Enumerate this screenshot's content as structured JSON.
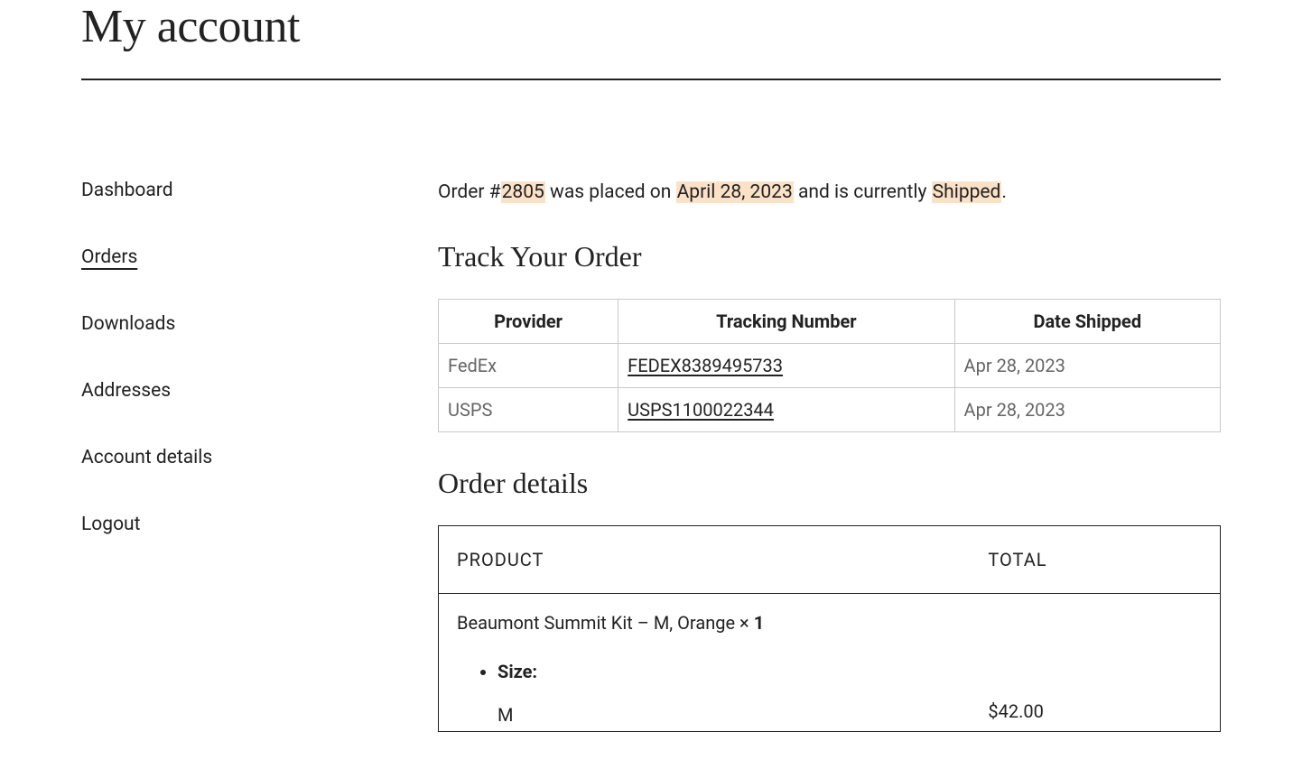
{
  "page": {
    "title": "My account"
  },
  "sidebar": {
    "items": [
      {
        "label": "Dashboard",
        "active": false
      },
      {
        "label": "Orders",
        "active": true
      },
      {
        "label": "Downloads",
        "active": false
      },
      {
        "label": "Addresses",
        "active": false
      },
      {
        "label": "Account details",
        "active": false
      },
      {
        "label": "Logout",
        "active": false
      }
    ]
  },
  "order_summary": {
    "prefix": "Order #",
    "order_number": "2805",
    "mid1": " was placed on ",
    "date": "April 28, 2023",
    "mid2": " and is currently ",
    "status": "Shipped",
    "suffix": "."
  },
  "track": {
    "heading": "Track Your Order",
    "headers": {
      "provider": "Provider",
      "tracking": "Tracking Number",
      "date": "Date Shipped"
    },
    "rows": [
      {
        "provider": "FedEx",
        "tracking": "FEDEX8389495733",
        "date": "Apr 28, 2023"
      },
      {
        "provider": "USPS",
        "tracking": "USPS1100022344",
        "date": "Apr 28, 2023"
      }
    ]
  },
  "details": {
    "heading": "Order details",
    "headers": {
      "product": "PRODUCT",
      "total": "TOTAL"
    },
    "item": {
      "name": "Beaumont Summit Kit – M, Orange ",
      "times": "× ",
      "qty": "1",
      "size_label": "Size:",
      "size_value": "M",
      "total": "$42.00"
    }
  }
}
